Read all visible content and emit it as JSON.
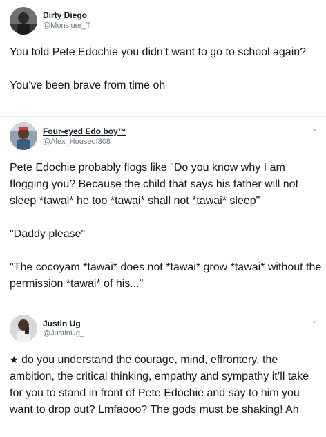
{
  "tweets": [
    {
      "name": "Dirty Diego",
      "handle": "@Monsiuer_T",
      "paragraphs": [
        "You told Pete Edochie you didn’t want to go to school again?",
        "You’ve been brave from time oh"
      ]
    },
    {
      "name": "Four-eyed Edo boy™",
      "handle": "@Alex_Houseof308",
      "chevron": "chevron-down-icon",
      "paragraphs": [
        "Pete Edochie probably flogs like \"Do you know why I am flogging you? Because the child that says his father will not sleep *tawai* he too *tawai* shall not *tawai* sleep\"",
        "\"Daddy please\"",
        "\"The cocoyam *tawai* does not *tawai* grow *tawai* without the permission *tawai* of his...\""
      ]
    },
    {
      "name": "Justin Ug",
      "handle": "@JustinUg_",
      "chevron": "chevron-down-icon",
      "star": "★",
      "paragraphs": [
        "do you understand the courage, mind, effrontery, the ambition, the critical thinking, empathy and sympathy it’ll take for you to stand  in front of Pete Edochie and say to him you want to drop out? Lmfaooo? The gods must be shaking! Ah"
      ]
    }
  ],
  "colors": {
    "text": "#14171a",
    "secondary": "#657786",
    "separator": "#e6ecf0"
  }
}
